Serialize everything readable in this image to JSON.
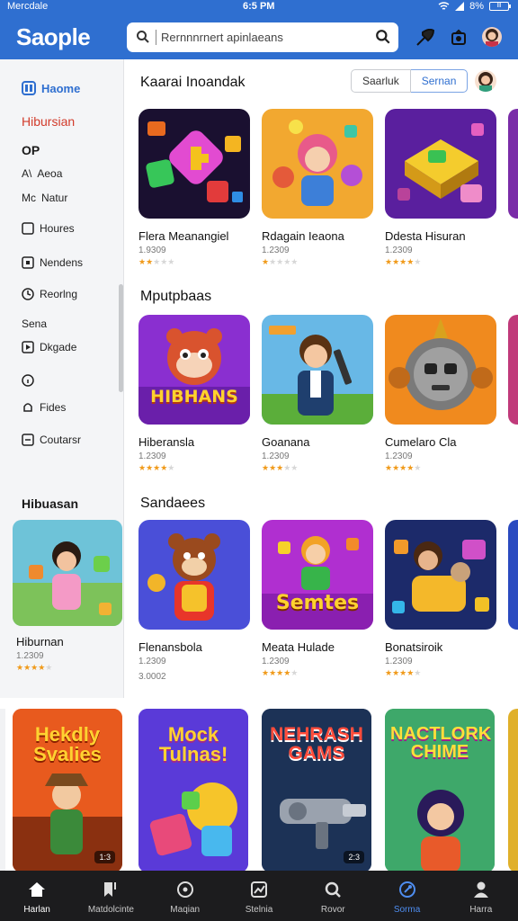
{
  "status": {
    "carrier": "Mercdale",
    "time": "6:5 PM",
    "battery": "8%",
    "battery_badge": "lll"
  },
  "header": {
    "brand": "Saople",
    "search_placeholder": "Rernnnrnert apinlaeans"
  },
  "sidebar": {
    "active_item": "Haome",
    "red_item": "Hibursian",
    "heading": "OP",
    "items": [
      "Aeoa",
      "Natur",
      "Houres",
      "Nendens",
      "Reorlng"
    ],
    "subheading": "Sena",
    "items2": [
      "Dkgade",
      "",
      "Fides",
      "Coutarsr"
    ],
    "feature": {
      "heading": "Hibuasan",
      "title": "Hiburnan",
      "sub": "1.2309",
      "rating": 4
    }
  },
  "main": {
    "section1": {
      "title": "Kaarai Inoandak",
      "tabs": [
        "Saarluk",
        "Sernan"
      ]
    },
    "row1": [
      {
        "title": "Flera Meanangiel",
        "sub": "1.9309",
        "rating": 2,
        "art": "gems"
      },
      {
        "title": "Rdagain Ieaona",
        "sub": "1.2309",
        "rating": 1,
        "art": "kids"
      },
      {
        "title": "Ddesta Hisuran",
        "sub": "1.2309",
        "rating": 4,
        "art": "cube"
      }
    ],
    "section2": {
      "title": "Mputpbaas"
    },
    "row2": [
      {
        "title": "Hiberansla",
        "sub": "1.2309",
        "rating": 4,
        "art": "bear",
        "art_text": "HIBHANS"
      },
      {
        "title": "Goanana",
        "sub": "1.2309",
        "rating": 3,
        "art": "boy"
      },
      {
        "title": "Cumelaro Cla",
        "sub": "1.2309",
        "rating": 4,
        "art": "robot"
      }
    ],
    "section3": {
      "title": "Sandaees"
    },
    "row3": [
      {
        "title": "Flenansbola",
        "sub": "1.2309",
        "sub2": "3.0002",
        "rating": 0,
        "art": "bear2"
      },
      {
        "title": "Meata Hulade",
        "sub": "1.2309",
        "rating": 4,
        "art": "hero",
        "art_text": "Semtes"
      },
      {
        "title": "Bonatsiroik",
        "sub": "1.2309",
        "rating": 4,
        "art": "friends"
      }
    ],
    "row4": [
      {
        "title": "Hekdly Svalies",
        "badge": "1:3",
        "art": "explorer"
      },
      {
        "title": "Mock Tulnas!",
        "art": "blocks"
      },
      {
        "title": "NEHRASH GAMS",
        "badge": "2:3",
        "art": "gun"
      },
      {
        "title": "NACTLORK CHIME",
        "art": "girl"
      }
    ]
  },
  "bottom_nav": [
    {
      "label": "Harlan",
      "icon": "home-icon"
    },
    {
      "label": "Matdolcinte",
      "icon": "bookmark-icon"
    },
    {
      "label": "Maqian",
      "icon": "compass-icon"
    },
    {
      "label": "Stelnia",
      "icon": "chart-icon"
    },
    {
      "label": "Rovor",
      "icon": "search-icon"
    },
    {
      "label": "Sorma",
      "icon": "location-icon",
      "active": true
    },
    {
      "label": "Harra",
      "icon": "profile-icon"
    }
  ],
  "colors": {
    "brand": "#2f6fd0",
    "accent_nav": "#4e8df0",
    "star": "#f09a1a",
    "nav_bg": "#1c1c1e"
  }
}
